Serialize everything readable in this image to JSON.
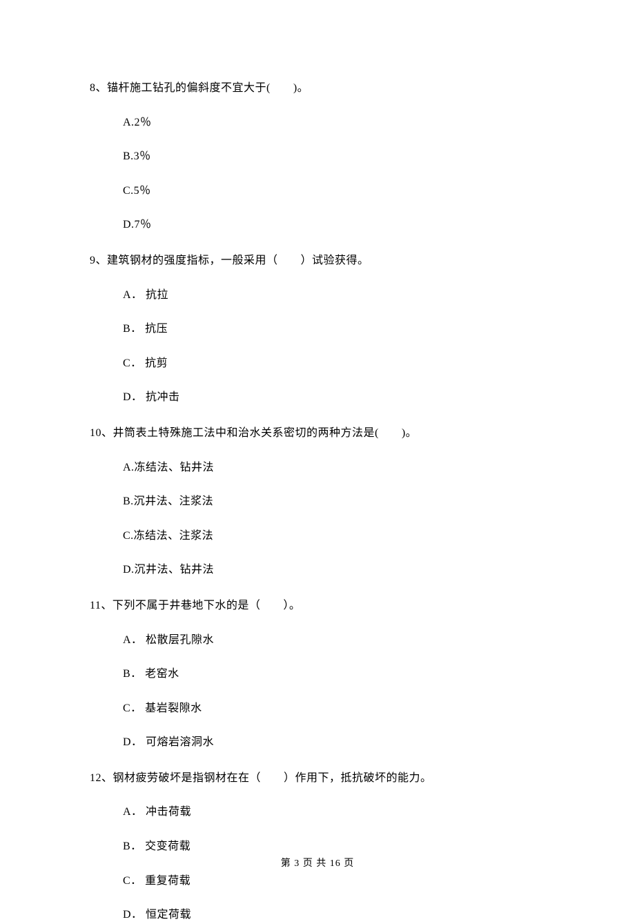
{
  "questions": [
    {
      "number": "8、",
      "text": "锚杆施工钻孔的偏斜度不宜大于(　　)。",
      "options": [
        {
          "label": "A.2％"
        },
        {
          "label": "B.3％"
        },
        {
          "label": "C.5％"
        },
        {
          "label": "D.7％"
        }
      ]
    },
    {
      "number": "9、",
      "text": "建筑钢材的强度指标，一般采用（　　）试验获得。",
      "options": [
        {
          "label": "A． 抗拉"
        },
        {
          "label": "B． 抗压"
        },
        {
          "label": "C． 抗剪"
        },
        {
          "label": "D． 抗冲击"
        }
      ]
    },
    {
      "number": "10、",
      "text": "井筒表土特殊施工法中和治水关系密切的两种方法是(　　)。",
      "options": [
        {
          "label": "A.冻结法、钻井法"
        },
        {
          "label": "B.沉井法、注浆法"
        },
        {
          "label": "C.冻结法、注浆法"
        },
        {
          "label": "D.沉井法、钻井法"
        }
      ]
    },
    {
      "number": "11、",
      "text": "下列不属于井巷地下水的是（　　）。",
      "options": [
        {
          "label": "A． 松散层孔隙水"
        },
        {
          "label": "B． 老窑水"
        },
        {
          "label": "C． 基岩裂隙水"
        },
        {
          "label": "D． 可熔岩溶洞水"
        }
      ]
    },
    {
      "number": "12、",
      "text": "钢材疲劳破坏是指钢材在在（　　）作用下，抵抗破坏的能力。",
      "options": [
        {
          "label": "A． 冲击荷载"
        },
        {
          "label": "B． 交变荷载"
        },
        {
          "label": "C． 重复荷载"
        },
        {
          "label": "D． 恒定荷载"
        }
      ]
    }
  ],
  "footer": "第 3 页 共 16 页"
}
